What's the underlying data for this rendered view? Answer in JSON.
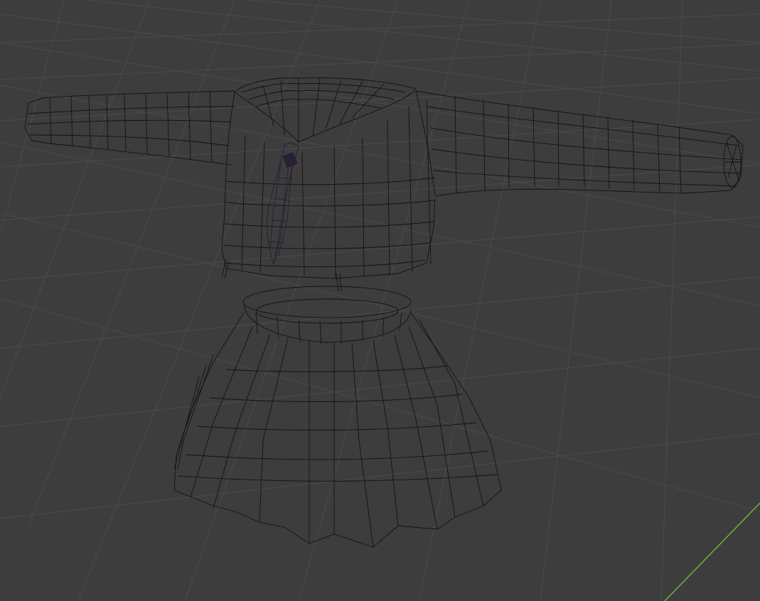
{
  "viewport": {
    "mode": "wireframe",
    "background_color": "#3d3d3d",
    "grid_color": "#4b4b4b",
    "wire_color": "#121212",
    "axis_y_color": "#6fb33e",
    "selection_color": "#5a3c6e",
    "objects": [
      {
        "name": "sailor-shirt",
        "kind": "wireframe-mesh"
      },
      {
        "name": "neck-scarf",
        "kind": "wireframe-mesh"
      },
      {
        "name": "pleated-skirt",
        "kind": "wireframe-mesh"
      }
    ]
  }
}
